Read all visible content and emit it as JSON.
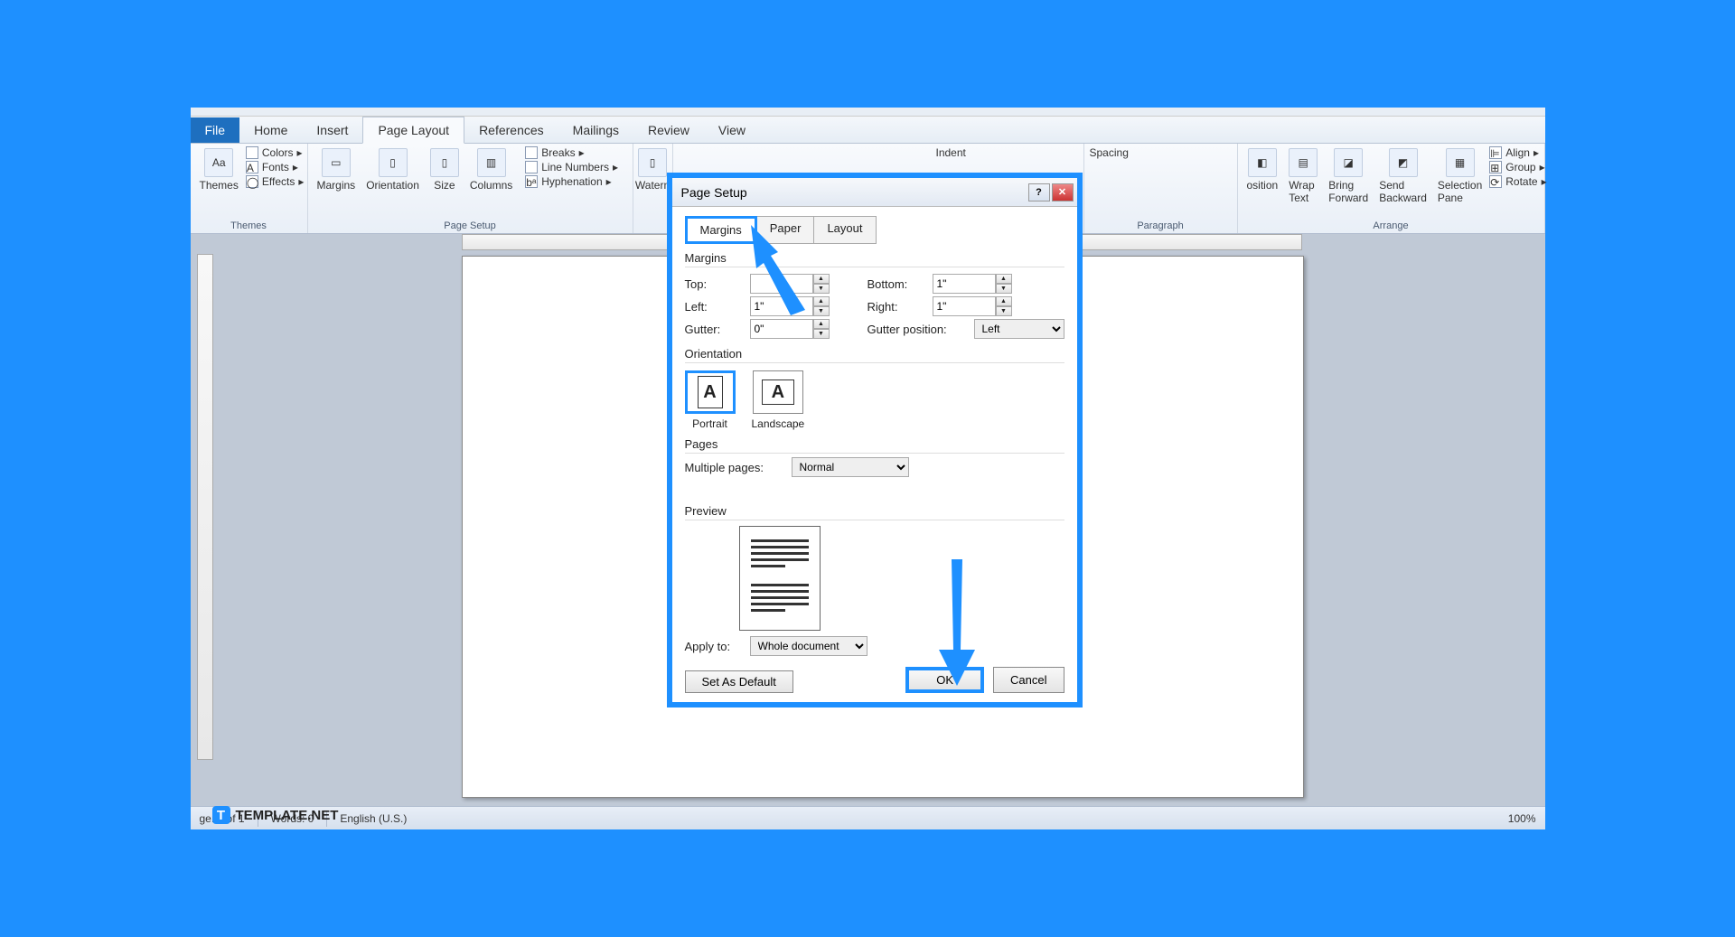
{
  "ribbon": {
    "file": "File",
    "tabs": [
      "Home",
      "Insert",
      "Page Layout",
      "References",
      "Mailings",
      "Review",
      "View"
    ],
    "active_tab": "Page Layout",
    "themes": {
      "title": "Themes",
      "colors": "Colors",
      "fonts": "Fonts",
      "effects": "Effects"
    },
    "page_setup": {
      "title": "Page Setup",
      "margins": "Margins",
      "orientation": "Orientation",
      "size": "Size",
      "columns": "Columns",
      "breaks": "Breaks",
      "line_numbers": "Line Numbers",
      "hyphenation": "Hyphenation"
    },
    "page_bg": {
      "watermark": "Watern"
    },
    "paragraph": {
      "title": "Paragraph",
      "indent": "Indent",
      "spacing": "Spacing"
    },
    "arrange": {
      "title": "Arrange",
      "position": "osition",
      "wrap": "Wrap Text",
      "forward": "Bring Forward",
      "backward": "Send Backward",
      "selection": "Selection Pane",
      "align": "Align",
      "group": "Group",
      "rotate": "Rotate"
    }
  },
  "dialog": {
    "title": "Page Setup",
    "tabs": {
      "margins": "Margins",
      "paper": "Paper",
      "layout": "Layout"
    },
    "sections": {
      "margins": "Margins",
      "orientation": "Orientation",
      "pages": "Pages",
      "preview": "Preview"
    },
    "labels": {
      "top": "Top:",
      "bottom": "Bottom:",
      "left": "Left:",
      "right": "Right:",
      "gutter": "Gutter:",
      "gutter_pos": "Gutter position:",
      "multiple": "Multiple pages:",
      "apply": "Apply to:",
      "portrait": "Portrait",
      "landscape": "Landscape"
    },
    "values": {
      "top": "",
      "bottom": "1\"",
      "left": "1\"",
      "right": "1\"",
      "gutter": "0\"",
      "gutter_pos": "Left",
      "multiple": "Normal",
      "apply": "Whole document"
    },
    "buttons": {
      "default": "Set As Default",
      "ok": "OK",
      "cancel": "Cancel"
    }
  },
  "status": {
    "page": "ge: 1 of 1",
    "words": "Words: 0",
    "lang": "English (U.S.)",
    "zoom": "100%"
  },
  "watermark": {
    "text": "TEMPLATE",
    "suffix": ".NET"
  }
}
